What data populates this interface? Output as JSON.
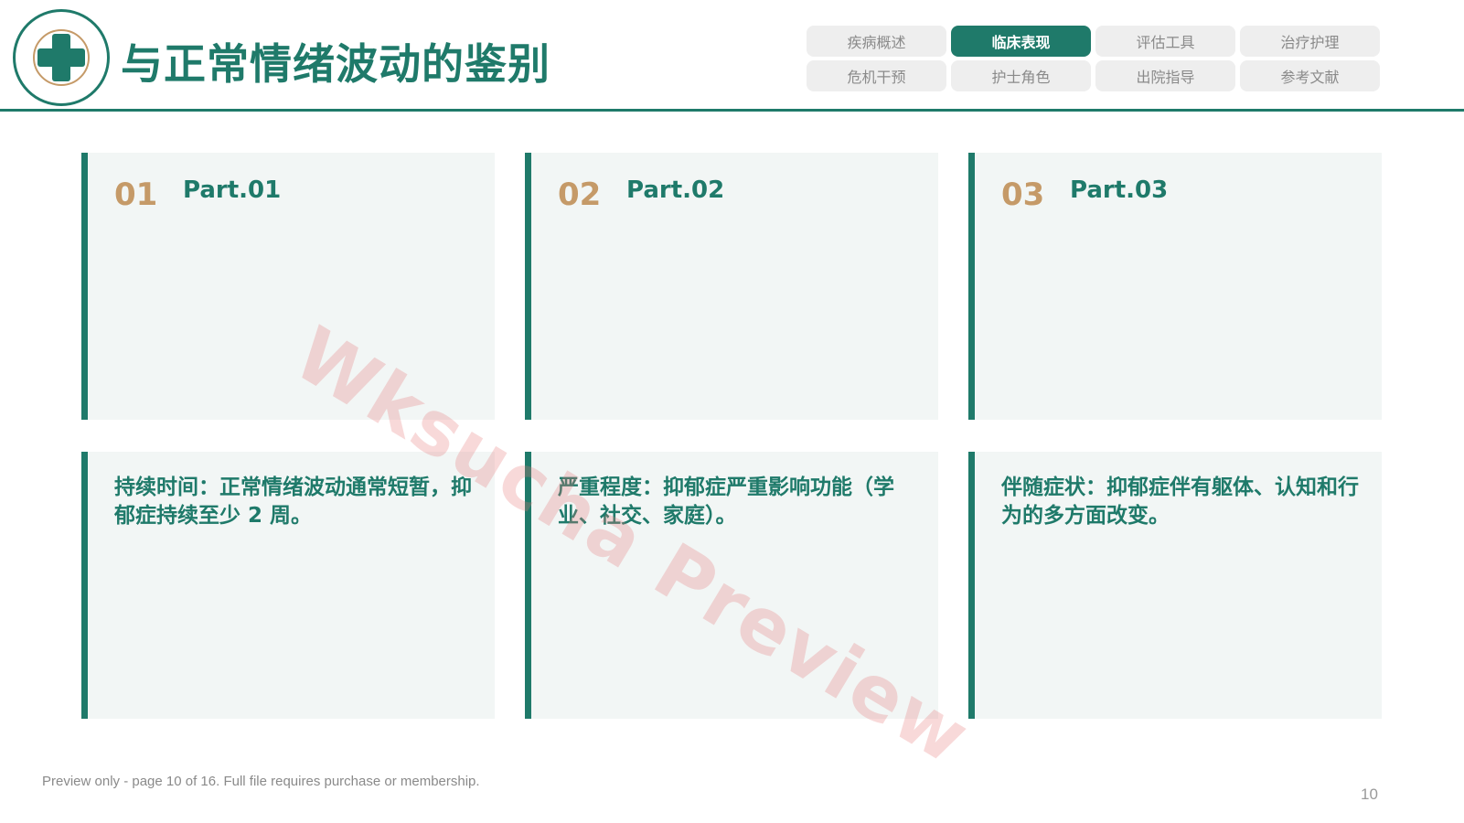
{
  "header": {
    "title": "与正常情绪波动的鉴别",
    "logo_icon": "medical-cross-icon",
    "nav_tabs": [
      {
        "label": "疾病概述",
        "active": false
      },
      {
        "label": "临床表现",
        "active": true
      },
      {
        "label": "评估工具",
        "active": false
      },
      {
        "label": "治疗护理",
        "active": false
      },
      {
        "label": "危机干预",
        "active": false
      },
      {
        "label": "护士角色",
        "active": false
      },
      {
        "label": "出院指导",
        "active": false
      },
      {
        "label": "参考文献",
        "active": false
      }
    ]
  },
  "cards_top": [
    {
      "number": "01",
      "label": "Part.01"
    },
    {
      "number": "02",
      "label": "Part.02"
    },
    {
      "number": "03",
      "label": "Part.03"
    }
  ],
  "cards_bottom": [
    {
      "text": "持续时间：正常情绪波动通常短暂，抑郁症持续至少 2 周。"
    },
    {
      "text": "严重程度：抑郁症严重影响功能（学业、社交、家庭）。"
    },
    {
      "text": "伴随症状：抑郁症伴有躯体、认知和行为的多方面改变。"
    }
  ],
  "watermark": "Wksucha Preview",
  "footer": {
    "note": "Preview only - page 10 of 16. Full file requires purchase or membership.",
    "page_number": "10"
  },
  "colors": {
    "primary": "#1f7a6a",
    "accent": "#c59a68",
    "card_background": "#f2f6f5",
    "tab_inactive": "#eeeeee"
  }
}
